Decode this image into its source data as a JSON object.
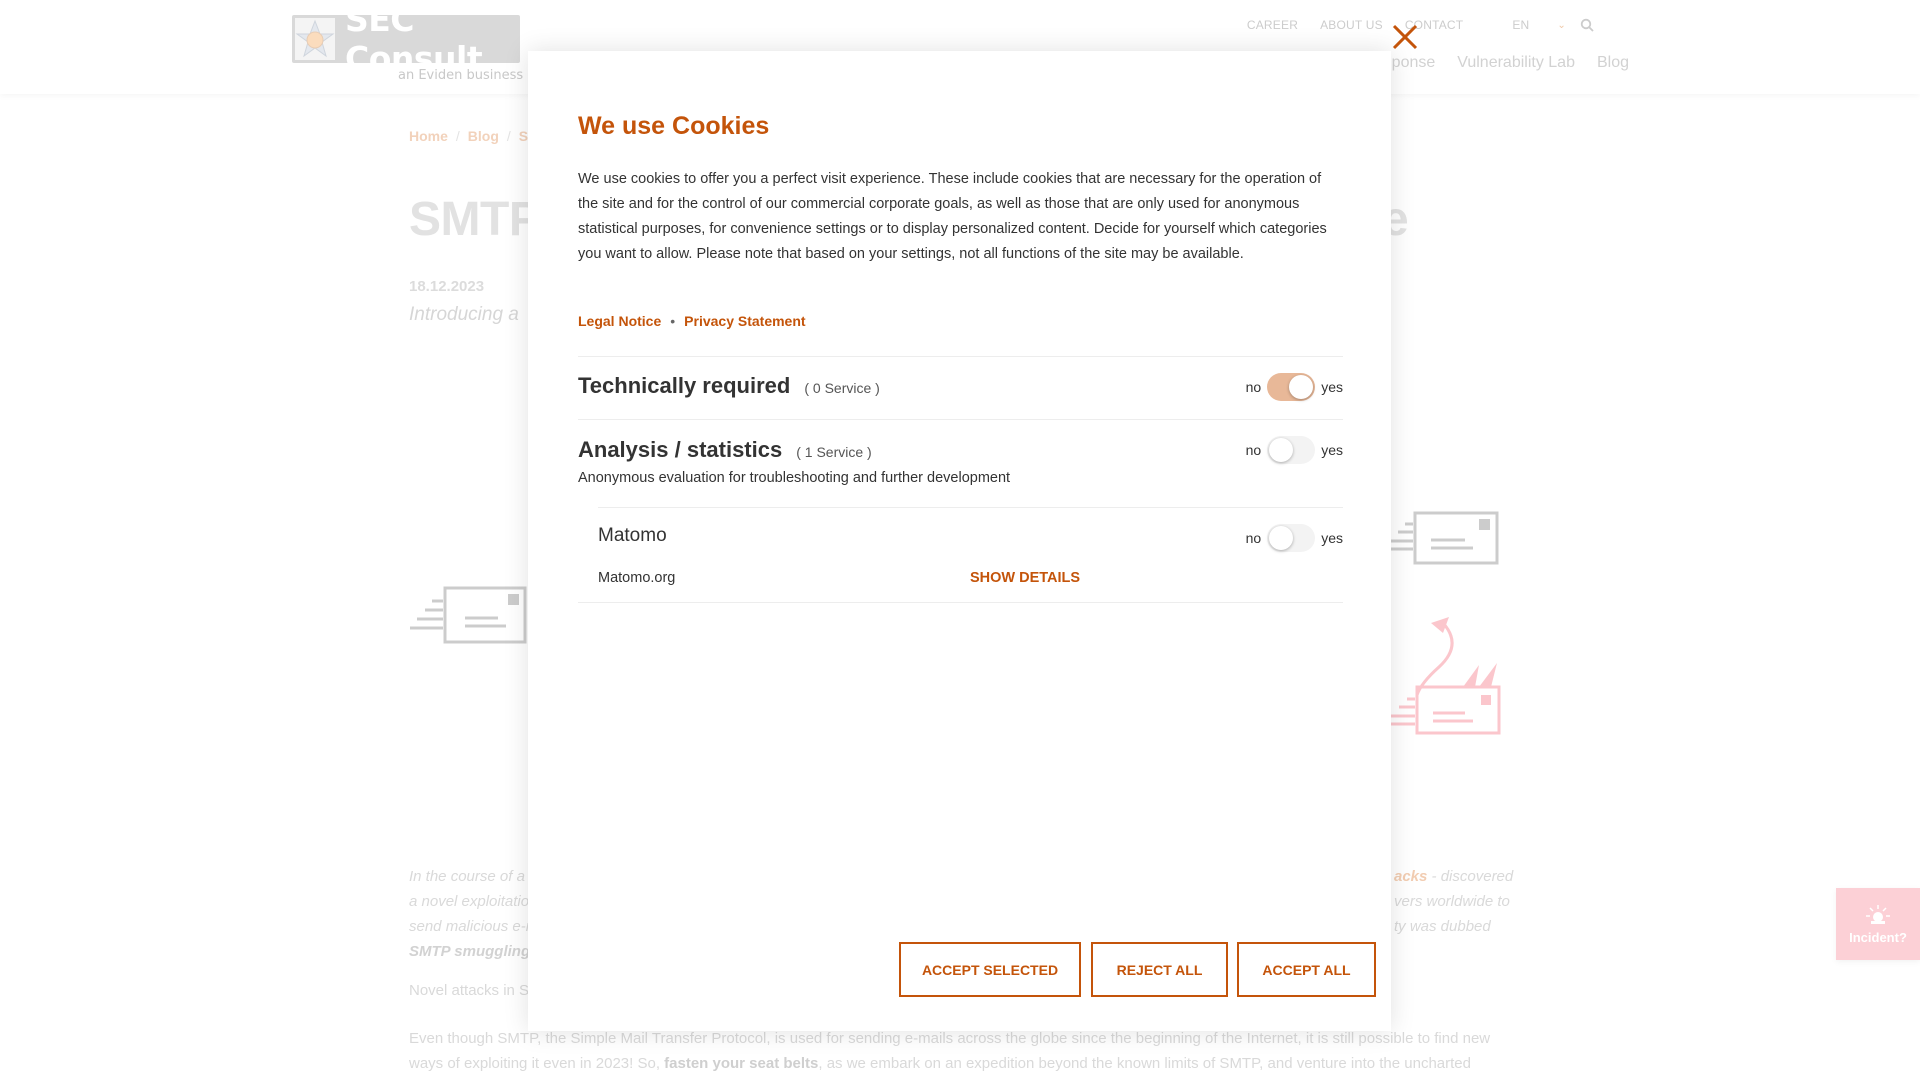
{
  "brand": {
    "logo_text": "SEC Consult",
    "logo_subtext": "an Eviden business",
    "accent_color": "#c4540a"
  },
  "top_nav": {
    "items": [
      "CAREER",
      "ABOUT US",
      "CONTACT"
    ],
    "language": "EN"
  },
  "main_nav": {
    "items": [
      "ponse",
      "Vulnerability Lab",
      "Blog"
    ]
  },
  "breadcrumb": {
    "items": [
      "Home",
      "Blog",
      "S"
    ],
    "separator": "/"
  },
  "article": {
    "title_start": "SMTP",
    "title_end": "e",
    "date": "18.12.2023",
    "subtitle": "Introducing a",
    "intro_left": [
      "In the course of a",
      "a novel exploitatio",
      "send malicious e-r",
      "SMTP smuggling."
    ],
    "intro_right_highlight": "acks",
    "intro_right": [
      " - discovered",
      "vers worldwide to",
      "ty was dubbed"
    ],
    "section_heading": "Novel attacks in S",
    "body_line1": "Even though SMTP, the Simple Mail Transfer Protocol, is used for sending e-mails across the globe since the beginning of the Internet, it is still possible to find new",
    "body_line2_a": "ways of exploiting it even in 2023! So, ",
    "body_line2_bold": "fasten your seat belts",
    "body_line2_b": ", as we embark on an expedition beyond the known limits of SMTP, and venture into the uncharted"
  },
  "incident_button": {
    "label": "Incident?",
    "icon": "siren-icon"
  },
  "cookie_modal": {
    "title": "We use Cookies",
    "description": "We use cookies to offer you a perfect visit experience. These include cookies that are necessary for the operation of the site and for the control of our commercial corporate goals, as well as those that are only used for anonymous statistical purposes, for convenience settings or to display personalized content. Decide for yourself which categories you want to allow. Please note that based on your settings, not all functions of the site may be available.",
    "links": {
      "legal_notice": "Legal Notice",
      "separator": "•",
      "privacy_statement": "Privacy Statement"
    },
    "toggle_no": "no",
    "toggle_yes": "yes",
    "categories": [
      {
        "title": "Technically required",
        "count": "( 0 Service )",
        "enabled": true
      },
      {
        "title": "Analysis / statistics",
        "count": "( 1 Service )",
        "description": "Anonymous evaluation for troubleshooting and further development",
        "enabled": false,
        "services": [
          {
            "name": "Matomo",
            "provider": "Matomo.org",
            "details_label": "SHOW DETAILS",
            "enabled": false
          }
        ]
      }
    ],
    "buttons": {
      "accept_selected": "ACCEPT SELECTED",
      "reject_all": "REJECT ALL",
      "accept_all": "ACCEPT ALL"
    }
  }
}
